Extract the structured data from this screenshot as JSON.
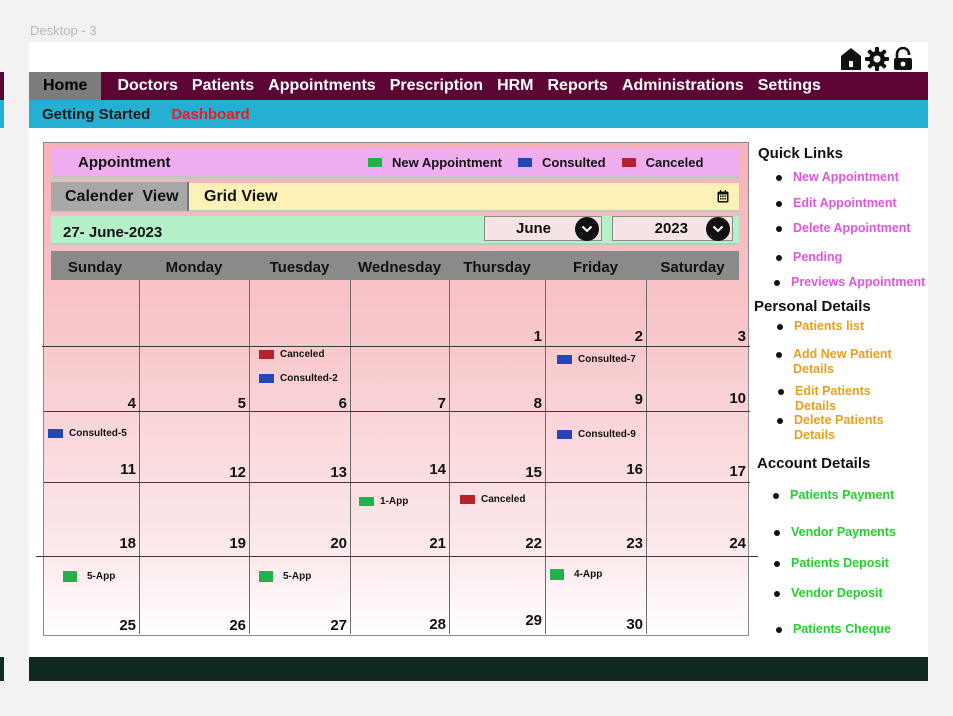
{
  "frame_label": "Desktop - 3",
  "colors": {
    "menubar": "#5c0535",
    "subbar": "#25afd2",
    "new_appointment": "#22b24c",
    "consulted": "#2446b8",
    "canceled": "#b5232a",
    "quick_link": "#e055e0",
    "personal_link": "#e6a020",
    "account_link": "#22d22a",
    "footer": "#0f2a1f"
  },
  "icons": [
    "home-icon",
    "gear-icon",
    "lock-icon"
  ],
  "menu": [
    "Home",
    "Doctors",
    "Patients",
    "Appointments",
    "Prescription",
    "HRM",
    "Reports",
    "Administrations",
    "Settings"
  ],
  "submenu": {
    "getting_started": "Getting Started",
    "dashboard": "Dashboard"
  },
  "appointment": {
    "title": "Appointment",
    "legend": {
      "new": "New Appointment",
      "consulted": "Consulted",
      "canceled": "Canceled"
    }
  },
  "views": {
    "calendar": "Calender  View",
    "grid": "Grid View"
  },
  "date": {
    "current": "27- June-2023",
    "month": "June",
    "year": "2023"
  },
  "days": [
    "Sunday",
    "Monday",
    "Tuesday",
    "Wednesday",
    "Thursday",
    "Friday",
    "Saturday"
  ],
  "calendar": {
    "numbers": [
      "1",
      "2",
      "3",
      "4",
      "5",
      "6",
      "7",
      "8",
      "9",
      "10",
      "11",
      "12",
      "13",
      "14",
      "15",
      "16",
      "17",
      "18",
      "19",
      "20",
      "21",
      "22",
      "23",
      "24",
      "25",
      "26",
      "27",
      "28",
      "29",
      "30"
    ],
    "events": [
      {
        "label": "Canceled",
        "type": "canceled"
      },
      {
        "label": "Consulted-2",
        "type": "consulted"
      },
      {
        "label": "Consulted-7",
        "type": "consulted"
      },
      {
        "label": "Consulted-5",
        "type": "consulted"
      },
      {
        "label": "Consulted-9",
        "type": "consulted"
      },
      {
        "label": "1-App",
        "type": "new"
      },
      {
        "label": "Canceled",
        "type": "canceled"
      },
      {
        "label": "5-App",
        "type": "new"
      },
      {
        "label": "5-App",
        "type": "new"
      },
      {
        "label": "4-App",
        "type": "new"
      }
    ]
  },
  "quick_links": {
    "title": "Quick Links",
    "items": [
      "New Appointment",
      "Edit Appointment",
      "Delete Appointment",
      "Pending",
      "Previews Appointment"
    ]
  },
  "personal_details": {
    "title": "Personal Details",
    "items": [
      "Patients list",
      "Add New Patient Details",
      "Edit Patients Details",
      "Delete Patients Details"
    ]
  },
  "account_details": {
    "title": "Account Details",
    "items": [
      "Patients Payment",
      "Vendor Payments",
      "Patients Deposit",
      "Vendor Deposit",
      "Patients Cheque"
    ]
  }
}
